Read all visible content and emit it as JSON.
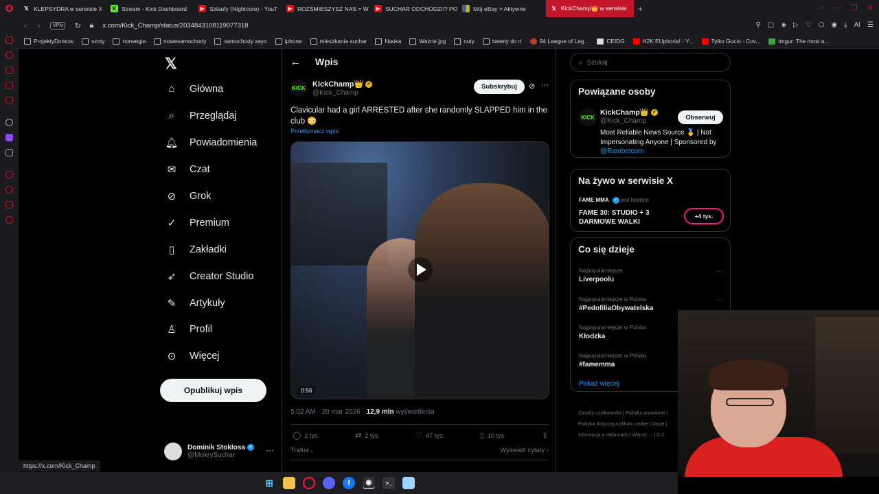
{
  "browser": {
    "tabs": [
      {
        "label": "KLEPSYDRA w serwisie X",
        "color": "#2a2a2e",
        "icon": "x-icon"
      },
      {
        "label": "Stream - Kick Dashboard",
        "color": "#53fc18",
        "icon": "kick-icon"
      },
      {
        "label": "Szlaufy (Nightcore) - YouT",
        "color": "#ff0000",
        "icon": "youtube-icon"
      },
      {
        "label": "ROZŚMIESZYSZ NAS = W",
        "color": "#ff0000",
        "icon": "youtube-icon"
      },
      {
        "label": "SUCHAR ODCHODZI!? PO",
        "color": "#ff0000",
        "icon": "youtube-icon"
      },
      {
        "label": "Mój eBay > Aktywne",
        "color": "#e5d33f",
        "icon": "ebay-icon"
      },
      {
        "label": "KickChamp👑 w serwisie",
        "color": "#c4162b",
        "icon": "x-icon",
        "active": true
      }
    ],
    "url": "x.com/Kick_Champ/status/2034843108119077318",
    "vpn_label": "VPN",
    "bookmarks": [
      "ProjektyDomow",
      "szoty",
      "norwegia",
      "nowesamochody",
      "samochody xayo",
      "iphone",
      "mieszkania suchar",
      "Nauka",
      "Ważne jpg",
      "nuty",
      "tweety do rt",
      "94 League of Leg...",
      "CEIDG",
      "H2K EUphoria! - Y...",
      "Tylko Gucio - Cov...",
      "Imgur: The most a..."
    ],
    "status_url": "https://x.com/Kick_Champ",
    "ai_label": "AI"
  },
  "nav": {
    "items": [
      {
        "label": "Główna",
        "icon": "home-icon"
      },
      {
        "label": "Przeglądaj",
        "icon": "search-icon"
      },
      {
        "label": "Powiadomienia",
        "icon": "bell-icon"
      },
      {
        "label": "Czat",
        "icon": "mail-icon"
      },
      {
        "label": "Grok",
        "icon": "grok-icon"
      },
      {
        "label": "Premium",
        "icon": "premium-icon"
      },
      {
        "label": "Zakładki",
        "icon": "bookmark-icon"
      },
      {
        "label": "Creator Studio",
        "icon": "rocket-icon"
      },
      {
        "label": "Artykuły",
        "icon": "article-icon"
      },
      {
        "label": "Profil",
        "icon": "person-icon"
      },
      {
        "label": "Więcej",
        "icon": "more-circle-icon"
      }
    ],
    "post_button": "Opublikuj wpis",
    "account": {
      "name": "Dominik Stoklosa",
      "handle": "@MokrySuchar"
    }
  },
  "tweet": {
    "header": "Wpis",
    "author": "KickChamp👑",
    "handle": "@Kick_Champ",
    "avatar_text": "KICK",
    "subscribe": "Subskrybuj",
    "text": "Clavicular had a girl ARRESTED after she randomly SLAPPED him in the club 😳",
    "translate": "Przetłumacz wpis",
    "video_duration": "0:56",
    "time": "5:02 AM · 20 mar 2026 · ",
    "views": "12,9 mln",
    "views_label": " wyświetlenia",
    "replies": "2 tys.",
    "reposts": "2 tys.",
    "likes": "47 tys.",
    "bookmarks": "10 tys.",
    "sort": "Trafne⌄",
    "quotes": "Wyświetl cytaty ›"
  },
  "right": {
    "search_placeholder": "Szukaj",
    "related": {
      "title": "Powiązane osoby",
      "name": "KickChamp👑",
      "handle": "@Kick_Champ",
      "follow": "Obserwuj",
      "bio": "Most Reliable News Source 🥇 | Not Impersonating Anyone | Sponsored by ",
      "bio_link": "@Rainbetcom"
    },
    "live": {
      "title": "Na żywo w serwisie X",
      "host": "FAME MMA",
      "host_suffix": "jest hostem",
      "stream_title": "FAME 30: STUDIO + 3 DARMOWE WALKI",
      "badge": "+4 tys."
    },
    "trends": {
      "title": "Co się dzieje",
      "items": [
        {
          "context": "Najpopularniejsze",
          "name": "Liverpoolu"
        },
        {
          "context": "Najpopularniejsze w Polska",
          "name": "#PedofiliaObywatelska"
        },
        {
          "context": "Najpopularniejsze w Polska",
          "name": "Kłodzka"
        },
        {
          "context": "Najpopularniejsze w Polska",
          "name": "#famemma"
        }
      ],
      "show_more": "Pokaż więcej"
    },
    "footer": "Zasady użytkownika | Polityka prywatnoś | Polityka dotycząca plików cookie | Dostę | Informacja o reklamach | Więcej ··· | © 2"
  }
}
